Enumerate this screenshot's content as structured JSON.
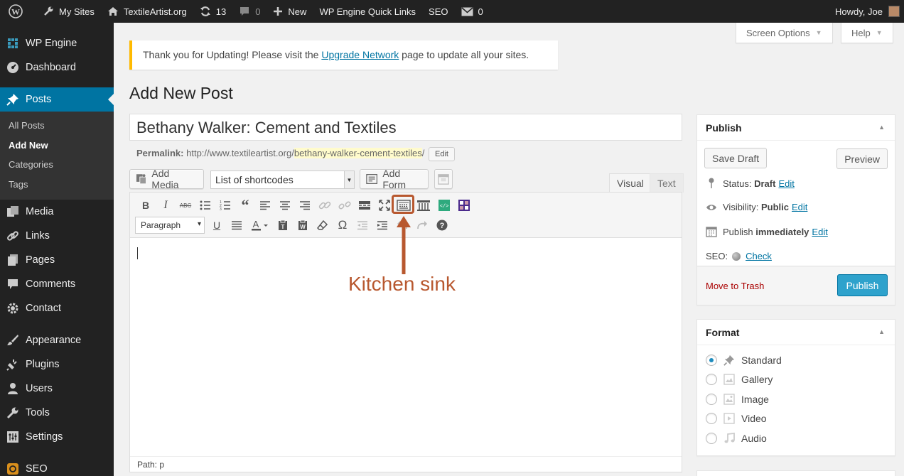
{
  "adminbar": {
    "my_sites": "My Sites",
    "site_name": "TextileArtist.org",
    "updates_count": "13",
    "comments_count": "0",
    "new_label": "New",
    "quick_links": "WP Engine Quick Links",
    "seo": "SEO",
    "messages_count": "0",
    "howdy": "Howdy, Joe"
  },
  "screen_options": {
    "screen_options": "Screen Options",
    "help": "Help"
  },
  "sidebar": {
    "items": [
      {
        "label": "WP Engine",
        "icon": "grid-icon"
      },
      {
        "label": "Dashboard",
        "icon": "dashboard-icon"
      },
      {
        "label": "Posts",
        "icon": "pin-icon"
      },
      {
        "label": "Media",
        "icon": "media-icon"
      },
      {
        "label": "Links",
        "icon": "link-icon"
      },
      {
        "label": "Pages",
        "icon": "pages-icon"
      },
      {
        "label": "Comments",
        "icon": "comment-icon"
      },
      {
        "label": "Contact",
        "icon": "gear-icon"
      },
      {
        "label": "Appearance",
        "icon": "brush-icon"
      },
      {
        "label": "Plugins",
        "icon": "plug-icon"
      },
      {
        "label": "Users",
        "icon": "user-icon"
      },
      {
        "label": "Tools",
        "icon": "wrench-icon"
      },
      {
        "label": "Settings",
        "icon": "settings-icon"
      },
      {
        "label": "SEO",
        "icon": "seo-icon"
      }
    ],
    "posts_submenu": [
      "All Posts",
      "Add New",
      "Categories",
      "Tags"
    ]
  },
  "notice": {
    "text_before": "Thank you for Updating! Please visit the ",
    "link": "Upgrade Network",
    "text_after": " page to update all your sites."
  },
  "page_title": "Add New Post",
  "post": {
    "title": "Bethany Walker: Cement and Textiles",
    "permalink_label": "Permalink:",
    "permalink_base": "http://www.textileartist.org/",
    "permalink_slug": "bethany-walker-cement-textiles",
    "permalink_end": "/",
    "edit_label": "Edit"
  },
  "editor": {
    "add_media": "Add Media",
    "shortcodes": "List of shortcodes",
    "add_form": "Add Form",
    "tab_visual": "Visual",
    "tab_text": "Text",
    "paragraph": "Paragraph",
    "path": "Path: p"
  },
  "annotation": {
    "label": "Kitchen sink",
    "color": "#b8582f"
  },
  "publish": {
    "title": "Publish",
    "save_draft": "Save Draft",
    "preview": "Preview",
    "status_label": "Status:",
    "status_value": "Draft",
    "visibility_label": "Visibility:",
    "visibility_value": "Public",
    "publish_label": "Publish",
    "publish_value": "immediately",
    "edit": "Edit",
    "seo_label": "SEO:",
    "seo_check": "Check",
    "trash": "Move to Trash",
    "publish_button": "Publish"
  },
  "format": {
    "title": "Format",
    "options": [
      "Standard",
      "Gallery",
      "Image",
      "Video",
      "Audio"
    ],
    "selected": "Standard"
  }
}
